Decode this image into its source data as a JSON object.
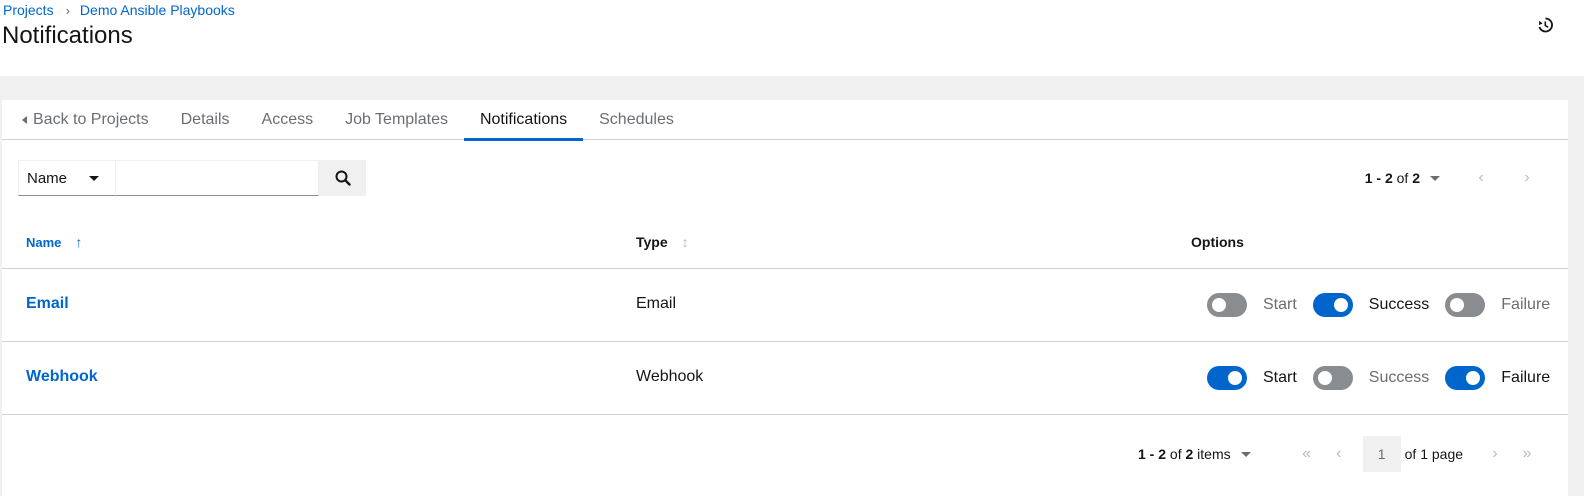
{
  "breadcrumb": {
    "root": "Projects",
    "current": "Demo Ansible Playbooks"
  },
  "page": {
    "title": "Notifications"
  },
  "tabs": [
    {
      "label": "Back to Projects"
    },
    {
      "label": "Details"
    },
    {
      "label": "Access"
    },
    {
      "label": "Job Templates"
    },
    {
      "label": "Notifications",
      "active": true
    },
    {
      "label": "Schedules"
    }
  ],
  "search": {
    "filter_label": "Name",
    "value": ""
  },
  "pager_top": {
    "range": "1 - 2",
    "of_label": "of",
    "total": "2"
  },
  "table": {
    "headers": {
      "name": "Name",
      "type": "Type",
      "options": "Options"
    },
    "rows": [
      {
        "name": "Email",
        "type": "Email",
        "start": false,
        "success": true,
        "failure": false
      },
      {
        "name": "Webhook",
        "type": "Webhook",
        "start": true,
        "success": false,
        "failure": true
      }
    ],
    "option_labels": {
      "start": "Start",
      "success": "Success",
      "failure": "Failure"
    }
  },
  "pager_bottom": {
    "range": "1 - 2",
    "of_label": "of",
    "total": "2",
    "items_label": "items",
    "page_value": "1",
    "page_suffix": "of 1 page"
  },
  "colors": {
    "accent": "#0066cc",
    "toggle_off": "#8a8d90"
  },
  "icons": {
    "history": "history-icon",
    "search": "search-icon"
  }
}
